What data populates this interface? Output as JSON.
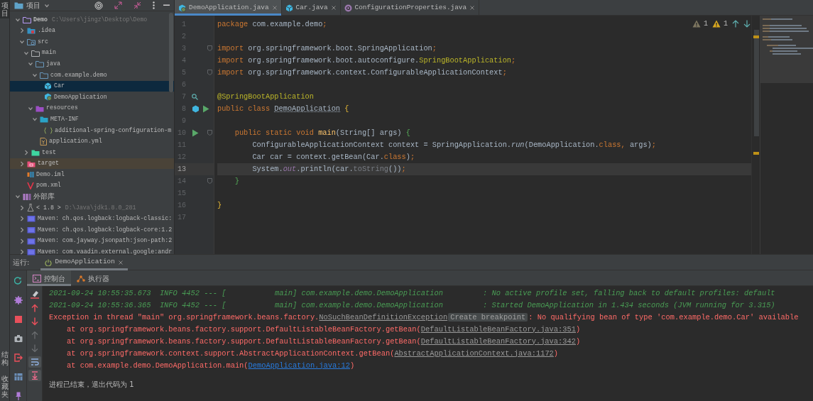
{
  "side_tabs": {
    "top": [
      {
        "label": "项目",
        "selected": true
      }
    ],
    "bottom": [
      {
        "label": "结构",
        "selected": false
      },
      {
        "label": "收藏夹",
        "selected": false
      }
    ]
  },
  "project": {
    "title": "项目",
    "tree": [
      {
        "label": "Demo",
        "kind": "module",
        "path": "C:\\Users\\jingz\\Desktop\\Demo",
        "expanded": true,
        "selected": false,
        "children": [
          {
            "label": ".idea",
            "kind": "idea-folder",
            "expanded": false,
            "selected": false
          },
          {
            "label": "src",
            "kind": "source-root",
            "expanded": true,
            "selected": false,
            "children": [
              {
                "label": "main",
                "kind": "folder",
                "expanded": true,
                "selected": false,
                "children": [
                  {
                    "label": "java",
                    "kind": "source-folder",
                    "expanded": true,
                    "selected": false,
                    "children": [
                      {
                        "label": "com.example.demo",
                        "kind": "package",
                        "expanded": true,
                        "selected": false,
                        "children": [
                          {
                            "label": "Car",
                            "kind": "class",
                            "selected": true
                          },
                          {
                            "label": "DemoApplication",
                            "kind": "spring-class",
                            "selected": false
                          }
                        ]
                      }
                    ]
                  },
                  {
                    "label": "resources",
                    "kind": "resources-folder",
                    "expanded": true,
                    "selected": false,
                    "children": [
                      {
                        "label": "META-INF",
                        "kind": "meta-folder",
                        "expanded": true,
                        "selected": false,
                        "children": [
                          {
                            "label": "additional-spring-configuration-m",
                            "kind": "json-file",
                            "selected": false
                          }
                        ]
                      },
                      {
                        "label": "application.yml",
                        "kind": "yml-file",
                        "selected": false
                      }
                    ]
                  }
                ]
              },
              {
                "label": "test",
                "kind": "test-folder",
                "expanded": false,
                "selected": false
              }
            ]
          },
          {
            "label": "target",
            "kind": "excluded-folder",
            "expanded": false,
            "selected": false
          },
          {
            "label": "Demo.iml",
            "kind": "iml-file",
            "selected": false
          },
          {
            "label": "pom.xml",
            "kind": "maven-file",
            "selected": false
          }
        ]
      },
      {
        "label": "外部库",
        "kind": "library-root",
        "expanded": true,
        "selected": false,
        "children": [
          {
            "label": "< 1.8 >",
            "kind": "sdk",
            "path": "D:\\Java\\jdk1.8.0_281",
            "expanded": false,
            "selected": false
          },
          {
            "label": "Maven: ch.qos.logback:logback-classic:",
            "kind": "library",
            "expanded": false,
            "selected": false
          },
          {
            "label": "Maven: ch.qos.logback:logback-core:1.2",
            "kind": "library",
            "expanded": false,
            "selected": false
          },
          {
            "label": "Maven: com.jayway.jsonpath:json-path:2",
            "kind": "library",
            "expanded": false,
            "selected": false
          },
          {
            "label": "Maven: com.vaadin.external.google:andr",
            "kind": "library",
            "expanded": false,
            "selected": false
          }
        ]
      }
    ]
  },
  "editor": {
    "tabs": [
      {
        "label": "DemoApplication.java",
        "kind": "spring-class",
        "selected": true
      },
      {
        "label": "Car.java",
        "kind": "class",
        "selected": false
      },
      {
        "label": "ConfigurationProperties.java",
        "kind": "annotation",
        "selected": false
      }
    ],
    "inspections": [
      {
        "kind": "weak-warning",
        "count": "1"
      },
      {
        "kind": "warning",
        "count": "1"
      }
    ],
    "lines": [
      {
        "number": "1",
        "current": false,
        "tokens": [
          {
            "kind": "kw",
            "text": "package"
          },
          {
            "kind": "plain",
            "text": " com.example.demo"
          },
          {
            "kind": "punct",
            "text": ";"
          }
        ]
      },
      {
        "number": "2",
        "current": false
      },
      {
        "number": "3",
        "current": false,
        "fold": true,
        "tokens": [
          {
            "kind": "kw",
            "text": "import"
          },
          {
            "kind": "plain",
            "text": " org.springframework.boot.SpringApplication"
          },
          {
            "kind": "punct",
            "text": ";"
          }
        ]
      },
      {
        "number": "4",
        "current": false,
        "tokens": [
          {
            "kind": "kw",
            "text": "import"
          },
          {
            "kind": "plain",
            "text": " org.springframework.boot.autoconfigure."
          },
          {
            "kind": "ann",
            "text": "SpringBootApplication"
          },
          {
            "kind": "punct",
            "text": ";"
          }
        ]
      },
      {
        "number": "5",
        "current": false,
        "fold": true,
        "tokens": [
          {
            "kind": "kw",
            "text": "import"
          },
          {
            "kind": "plain",
            "text": " org.springframework.context.ConfigurableApplicationContext"
          },
          {
            "kind": "punct",
            "text": ";"
          }
        ]
      },
      {
        "number": "6",
        "current": false
      },
      {
        "number": "7",
        "current": false,
        "usages_marker": true,
        "tokens": [
          {
            "kind": "ann",
            "text": "@SpringBootApplication"
          }
        ]
      },
      {
        "number": "8",
        "current": false,
        "bean_marker": true,
        "run_marker": true,
        "tokens": [
          {
            "kind": "kw",
            "text": "public class "
          },
          {
            "kind": "warn",
            "text": "DemoApplication"
          },
          {
            "kind": "brace",
            "text": " {"
          }
        ]
      },
      {
        "number": "9",
        "current": false
      },
      {
        "number": "10",
        "current": false,
        "fold": true,
        "run_marker": true,
        "tokens": [
          {
            "kind": "kw",
            "text": "    public static void "
          },
          {
            "kind": "method",
            "text": "main"
          },
          {
            "kind": "plain",
            "text": "(String[] args) "
          },
          {
            "kind": "brace2",
            "text": "{"
          }
        ]
      },
      {
        "number": "11",
        "current": false,
        "tokens": [
          {
            "kind": "plain",
            "text": "        ConfigurableApplicationContext context = SpringApplication."
          },
          {
            "kind": "call",
            "text": "run"
          },
          {
            "kind": "plain",
            "text": "(DemoApplication."
          },
          {
            "kind": "kw",
            "text": "class, "
          },
          {
            "kind": "plain",
            "text": "args)"
          },
          {
            "kind": "punct",
            "text": ";"
          }
        ]
      },
      {
        "number": "12",
        "current": false,
        "tokens": [
          {
            "kind": "plain",
            "text": "        Car car = context.getBean(Car."
          },
          {
            "kind": "kw",
            "text": "class"
          },
          {
            "kind": "plain",
            "text": ")"
          },
          {
            "kind": "punct",
            "text": ";"
          }
        ]
      },
      {
        "number": "13",
        "current": true,
        "tokens": [
          {
            "kind": "plain",
            "text": "        System."
          },
          {
            "kind": "field",
            "text": "out"
          },
          {
            "kind": "plain",
            "text": ".println(car."
          },
          {
            "kind": "dim",
            "text": "toString"
          },
          {
            "kind": "plain",
            "text": "())"
          },
          {
            "kind": "punct",
            "text": ";"
          }
        ]
      },
      {
        "number": "14",
        "current": false,
        "fold": true,
        "tokens": [
          {
            "kind": "brace2",
            "text": "    }"
          }
        ]
      },
      {
        "number": "15",
        "current": false
      },
      {
        "number": "16",
        "current": false,
        "tokens": [
          {
            "kind": "brace",
            "text": "}"
          }
        ]
      },
      {
        "number": "17",
        "current": false
      }
    ]
  },
  "run": {
    "label": "运行:",
    "tabs": [
      {
        "label": "DemoApplication",
        "selected": true
      }
    ],
    "subtabs": [
      {
        "label": "控制台",
        "kind": "console",
        "selected": true
      },
      {
        "label": "执行器",
        "kind": "services",
        "selected": false
      }
    ],
    "tools": [
      {
        "kind": "rerun"
      },
      {
        "kind": "settings"
      },
      {
        "kind": "stop"
      },
      {
        "kind": "camera"
      },
      {
        "kind": "exit"
      },
      {
        "kind": "layout"
      },
      {
        "kind": "pin"
      }
    ],
    "console_tools": [
      {
        "kind": "clear",
        "disabled": false,
        "on": false
      },
      {
        "kind": "prev-error",
        "disabled": false,
        "on": false
      },
      {
        "kind": "next-error",
        "disabled": false,
        "on": false
      },
      {
        "kind": "up",
        "disabled": true,
        "on": false
      },
      {
        "kind": "down",
        "disabled": true,
        "on": false
      },
      {
        "kind": "wrap",
        "disabled": false,
        "on": true
      },
      {
        "kind": "scroll-end",
        "disabled": false,
        "on": true
      }
    ],
    "console": [
      [
        {
          "kind": "info",
          "text": "2021-09-24 10:55:35.673  INFO 4452 --- [           main] com.example.demo.DemoApplication         : No active profile set, falling back to default profiles: default"
        }
      ],
      [
        {
          "kind": "info",
          "text": "2021-09-24 10:55:36.365  INFO 4452 --- [           main] com.example.demo.DemoApplication         : Started DemoApplication in 1.434 seconds (JVM running for 3.315)"
        }
      ],
      [
        {
          "kind": "error",
          "text": "Exception in thread \"main\" org.springframework.beans.factory."
        },
        {
          "kind": "muted-link",
          "text": "NoSuchBeanDefinitionException"
        },
        {
          "kind": "hint",
          "text": "Create breakpoint"
        },
        {
          "kind": "error",
          "text": ": No qualifying bean of type 'com.example.demo.Car' available"
        }
      ],
      [
        {
          "kind": "error",
          "text": "    at org.springframework.beans.factory.support.DefaultListableBeanFactory.getBean("
        },
        {
          "kind": "muted-link",
          "text": "DefaultListableBeanFactory.java:351"
        },
        {
          "kind": "error",
          "text": ")"
        }
      ],
      [
        {
          "kind": "error",
          "text": "    at org.springframework.beans.factory.support.DefaultListableBeanFactory.getBean("
        },
        {
          "kind": "muted-link",
          "text": "DefaultListableBeanFactory.java:342"
        },
        {
          "kind": "error",
          "text": ")"
        }
      ],
      [
        {
          "kind": "error",
          "text": "    at org.springframework.context.support.AbstractApplicationContext.getBean("
        },
        {
          "kind": "muted-link",
          "text": "AbstractApplicationContext.java:1172"
        },
        {
          "kind": "error",
          "text": ")"
        }
      ],
      [
        {
          "kind": "error",
          "text": "    at com.example.demo.DemoApplication.main("
        },
        {
          "kind": "link",
          "text": "DemoApplication.java:12"
        },
        {
          "kind": "error",
          "text": ")"
        }
      ],
      [
        {
          "kind": "exit-status",
          "text": "进程已结束，退出代码为 1"
        }
      ]
    ]
  }
}
